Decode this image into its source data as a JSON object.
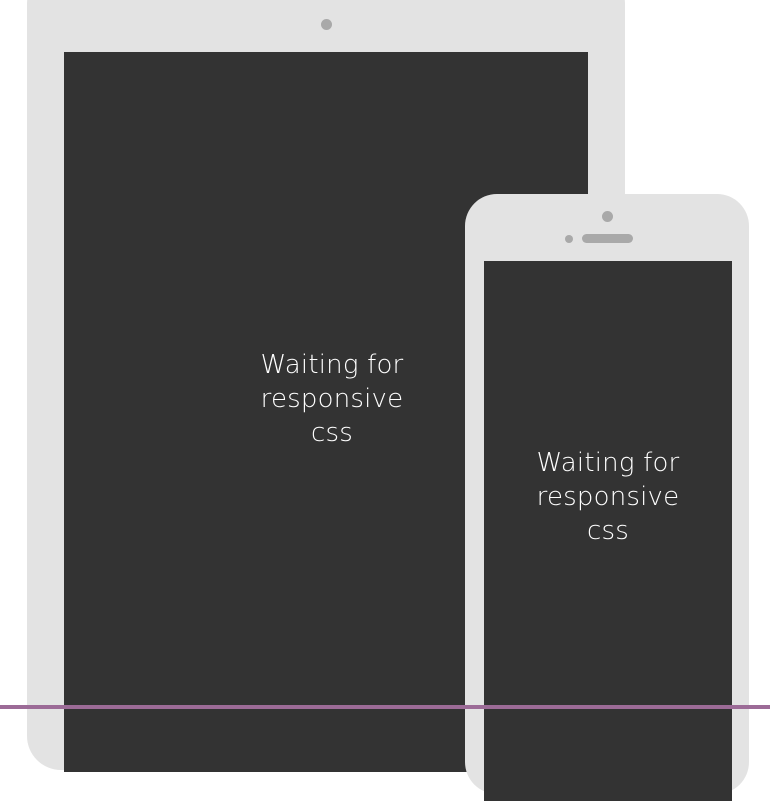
{
  "tablet": {
    "message_lines": [
      "Waiting for",
      "responsive",
      "css"
    ]
  },
  "phone": {
    "message_lines": [
      "Waiting for",
      "responsive",
      "css"
    ]
  },
  "colors": {
    "device_frame": "#e3e3e3",
    "screen": "#333333",
    "accent": "#9c6b97"
  }
}
